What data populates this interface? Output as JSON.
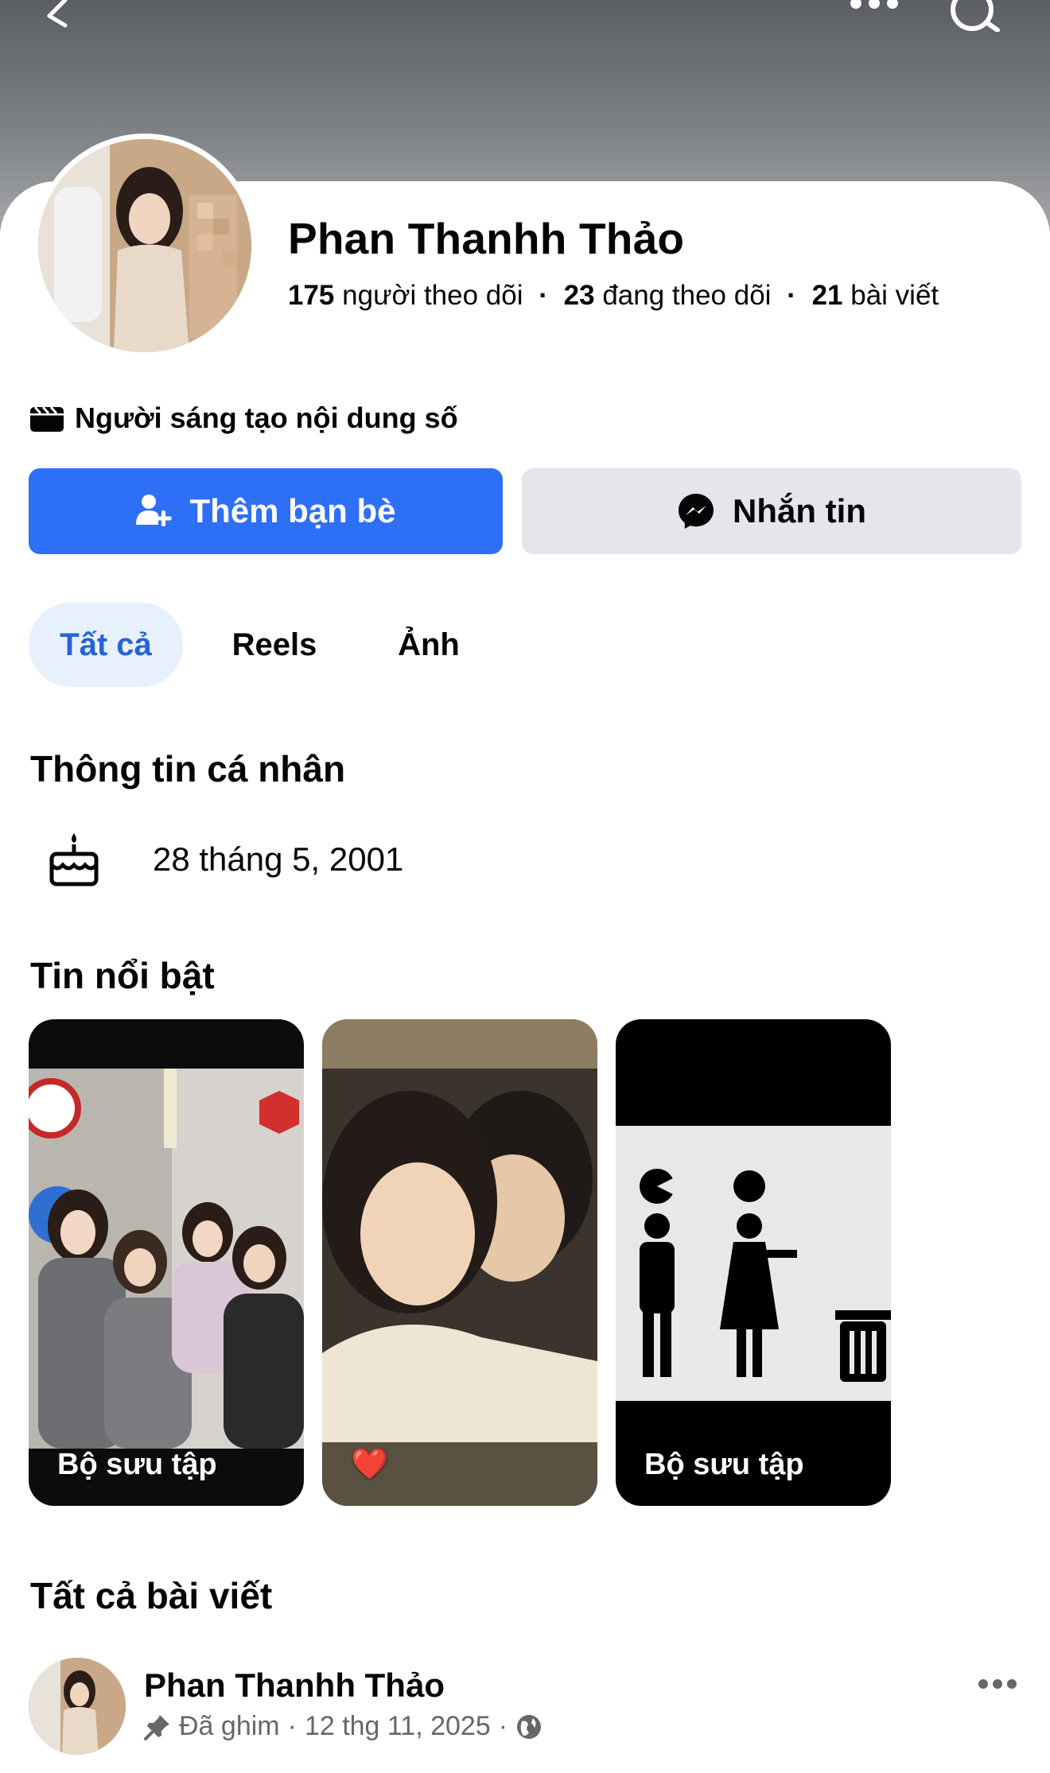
{
  "profile": {
    "name": "Phan Thanhh Thảo",
    "followers_count": "175",
    "followers_label": "người theo dõi",
    "following_count": "23",
    "following_label": "đang theo dõi",
    "posts_count": "21",
    "posts_label": "bài viết",
    "separator": "·",
    "category": "Người sáng tạo nội dung số"
  },
  "actions": {
    "add_friend": "Thêm bạn bè",
    "message": "Nhắn tin"
  },
  "tabs": [
    {
      "label": "Tất cả",
      "active": true
    },
    {
      "label": "Reels",
      "active": false
    },
    {
      "label": "Ảnh",
      "active": false
    }
  ],
  "about": {
    "title": "Thông tin cá nhân",
    "birthday": "28 tháng 5, 2001"
  },
  "highlights": {
    "title": "Tin nổi bật",
    "items": [
      {
        "label": "Bộ sưu tập"
      },
      {
        "label": "❤️"
      },
      {
        "label": "Bộ sưu tập"
      }
    ]
  },
  "posts": {
    "title": "Tất cả bài viết",
    "first": {
      "author": "Phan Thanhh Thảo",
      "pinned_label": "Đã ghim",
      "date": "12 thg 11, 2025",
      "separator": "·"
    }
  },
  "colors": {
    "primary": "#2d6ff7",
    "active_tab_bg": "#e7f0fd",
    "active_tab_text": "#2563d6",
    "secondary_button": "#e4e6eb"
  },
  "icons": {
    "back": "chevron-left-icon",
    "more": "more-dots-icon",
    "search": "search-icon",
    "category": "clapperboard-icon",
    "add_friend": "add-friend-icon",
    "message": "messenger-icon",
    "birthday": "birthday-cake-icon",
    "pin": "pin-icon",
    "privacy": "globe-icon"
  }
}
